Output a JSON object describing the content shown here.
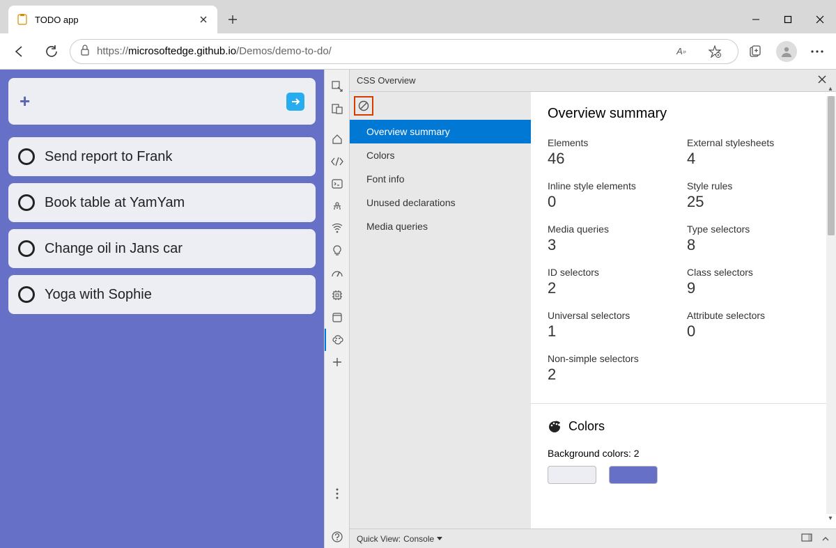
{
  "browser": {
    "tab_title": "TODO app",
    "url_host": "microsoftedge.github.io",
    "url_prefix": "https://",
    "url_path": "/Demos/demo-to-do/"
  },
  "todo": {
    "items": [
      "Send report to Frank",
      "Book table at YamYam",
      "Change oil in Jans car",
      "Yoga with Sophie"
    ]
  },
  "devtools": {
    "panel_title": "CSS Overview",
    "nav": [
      "Overview summary",
      "Colors",
      "Font info",
      "Unused declarations",
      "Media queries"
    ],
    "summary_heading": "Overview summary",
    "stats": [
      {
        "label": "Elements",
        "value": "46"
      },
      {
        "label": "External stylesheets",
        "value": "4"
      },
      {
        "label": "Inline style elements",
        "value": "0"
      },
      {
        "label": "Style rules",
        "value": "25"
      },
      {
        "label": "Media queries",
        "value": "3"
      },
      {
        "label": "Type selectors",
        "value": "8"
      },
      {
        "label": "ID selectors",
        "value": "2"
      },
      {
        "label": "Class selectors",
        "value": "9"
      },
      {
        "label": "Universal selectors",
        "value": "1"
      },
      {
        "label": "Attribute selectors",
        "value": "0"
      },
      {
        "label": "Non-simple selectors",
        "value": "2"
      }
    ],
    "colors_heading": "Colors",
    "bg_colors_label": "Background colors: 2",
    "swatches": [
      "#eceef4",
      "#6770c7"
    ],
    "footer_quickview": "Quick View:",
    "footer_console": "Console"
  }
}
